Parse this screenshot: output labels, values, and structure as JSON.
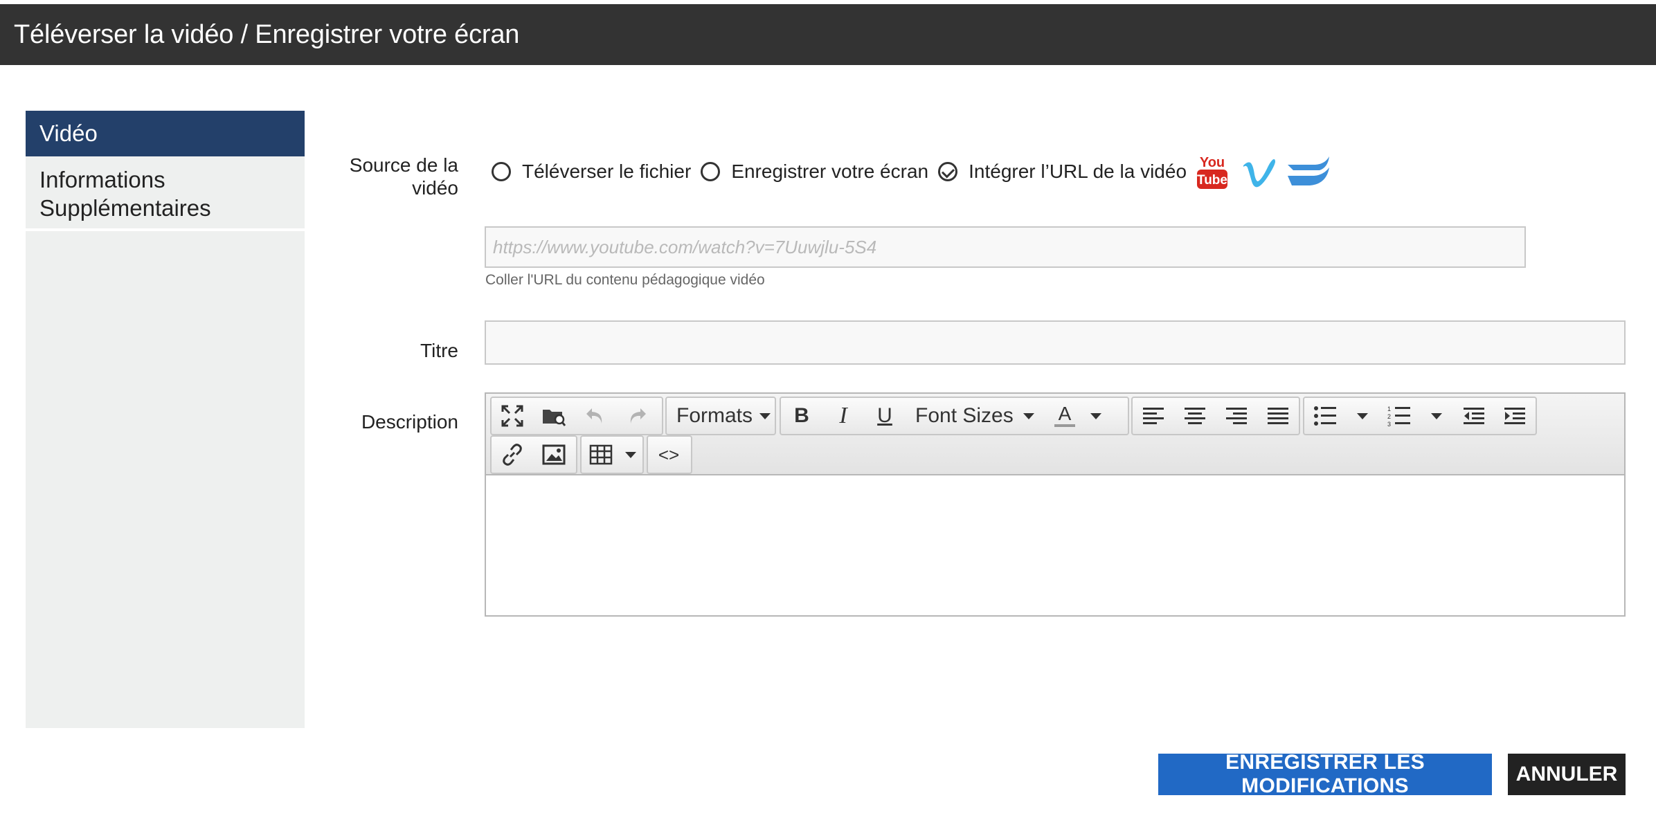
{
  "dialog": {
    "title": "Téléverser la vidéo / Enregistrer votre écran"
  },
  "sidebar": {
    "items": [
      {
        "label": "Vidéo",
        "active": true
      },
      {
        "label": "Informations Supplémentaires",
        "active": false
      }
    ]
  },
  "source": {
    "label": "Source de la vidéo",
    "options": [
      {
        "label": "Téléverser le fichier",
        "checked": false
      },
      {
        "label": "Enregistrer votre écran",
        "checked": false
      },
      {
        "label": "Intégrer l’URL de la vidéo",
        "checked": true
      }
    ],
    "logos": {
      "youtube_top": "You",
      "youtube_bottom": "Tube"
    },
    "logo_colors": {
      "youtube": "#d8281f",
      "vimeo": "#3fb4e9",
      "wistia": "#3d8fd9"
    }
  },
  "url": {
    "value": "",
    "placeholder": "https://www.youtube.com/watch?v=7Uuwjlu-5S4",
    "help": "Coller l'URL du contenu pédagogique vidéo"
  },
  "title_field": {
    "label": "Titre",
    "value": ""
  },
  "description": {
    "label": "Description",
    "toolbar": {
      "formats_label": "Formats",
      "font_sizes_label": "Font Sizes",
      "bold_glyph": "B",
      "italic_glyph": "I",
      "underline_glyph": "U",
      "color_glyph": "A",
      "code_glyph": "<>"
    },
    "content": ""
  },
  "actions": {
    "save_label": "ENREGISTRER LES MODIFICATIONS",
    "cancel_label": "ANNULER"
  },
  "colors": {
    "titlebar": "#333333",
    "sidebar_active": "#23406a",
    "sidebar_bg": "#eef0ef",
    "primary_button": "#2169c5",
    "cancel_button": "#222222"
  }
}
